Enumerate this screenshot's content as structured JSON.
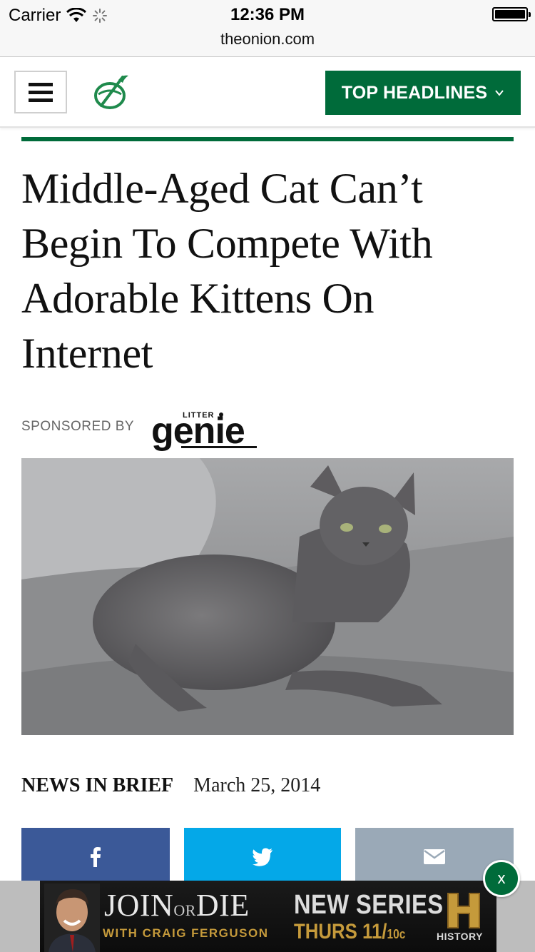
{
  "status_bar": {
    "carrier": "Carrier",
    "time": "12:36 PM",
    "url": "theonion.com"
  },
  "header": {
    "headlines_label": "TOP HEADLINES",
    "brand_color": "#006b3a"
  },
  "article": {
    "title": "Middle-Aged Cat Can’t Begin To Compete With Adorable Kittens On Internet",
    "sponsor_label": "SPONSORED BY",
    "sponsor_brand": "LITTER genie",
    "section": "NEWS IN BRIEF",
    "date": "March 25, 2014"
  },
  "share": {
    "facebook_color": "#3b5998",
    "twitter_color": "#04a8e8",
    "email_color": "#9aa9b7"
  },
  "ad": {
    "title_join": "JOIN",
    "title_or": "OR",
    "title_die": "DIE",
    "subtitle": "WITH CRAIG FERGUSON",
    "series": "NEW SERIES",
    "time_main": "THURS 11/",
    "time_small": "10c",
    "network": "HISTORY",
    "close_label": "x"
  }
}
